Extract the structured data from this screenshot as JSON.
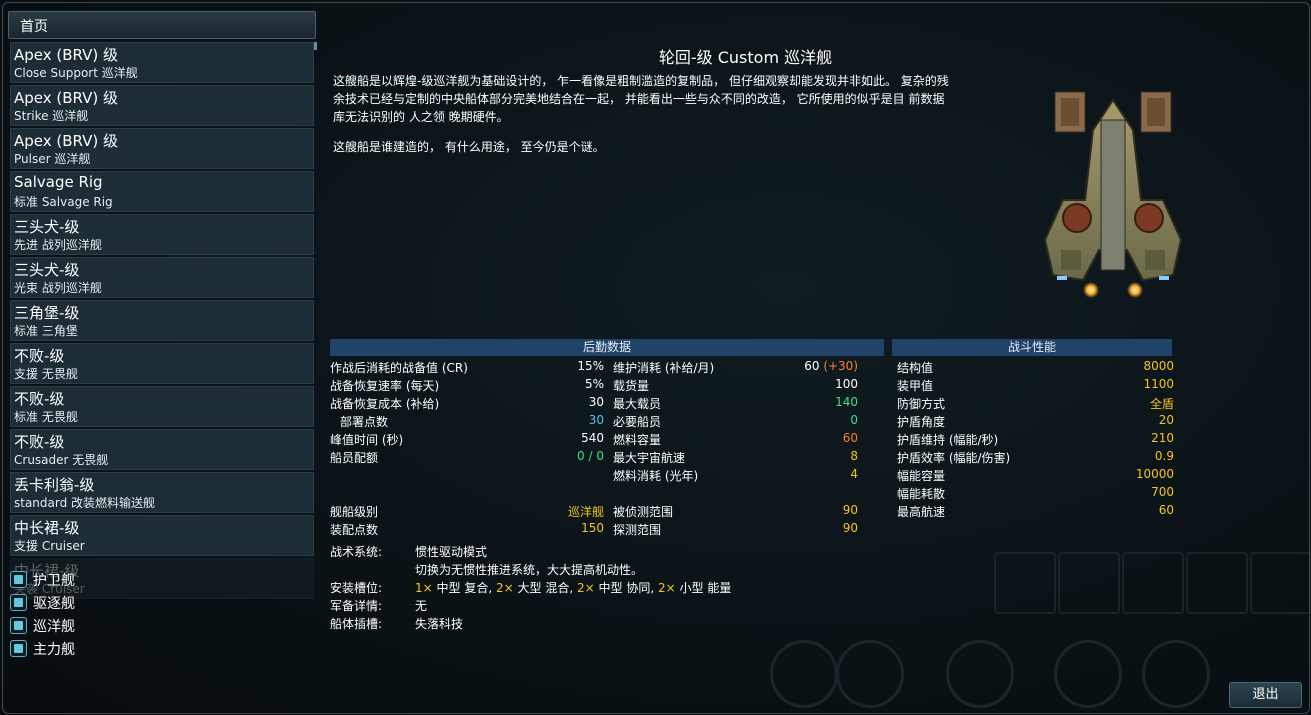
{
  "nav": {
    "home_label": "首页",
    "exit_label": "退出"
  },
  "ships": [
    {
      "name": "Apex (BRV) 级",
      "variant": "Close Support 巡洋舰"
    },
    {
      "name": "Apex (BRV) 级",
      "variant": "Strike 巡洋舰"
    },
    {
      "name": "Apex (BRV) 级",
      "variant": "Pulser 巡洋舰"
    },
    {
      "name": "Salvage Rig",
      "variant": "标准 Salvage Rig"
    },
    {
      "name": "三头犬-级",
      "variant": "先进 战列巡洋舰"
    },
    {
      "name": "三头犬-级",
      "variant": "光束 战列巡洋舰"
    },
    {
      "name": "三角堡-级",
      "variant": "标准 三角堡"
    },
    {
      "name": "不败-级",
      "variant": "支援 无畏舰"
    },
    {
      "name": "不败-级",
      "variant": "标准 无畏舰"
    },
    {
      "name": "不败-级",
      "variant": "Crusader 无畏舰"
    },
    {
      "name": "丢卡利翁-级",
      "variant": "standard 改装燃料输送舰"
    },
    {
      "name": "中长裙-级",
      "variant": "支援 Cruiser"
    },
    {
      "name": "中长裙-级",
      "variant": "突袭 Cruiser"
    }
  ],
  "categories": [
    {
      "label": "护卫舰",
      "checked": true
    },
    {
      "label": "驱逐舰",
      "checked": true
    },
    {
      "label": "巡洋舰",
      "checked": true
    },
    {
      "label": "主力舰",
      "checked": true
    }
  ],
  "detail": {
    "title": "轮回-级 Custom 巡洋舰",
    "desc1": "这艘船是以辉煌-级巡洋舰为基础设计的， 乍一看像是粗制滥造的复制品， 但仔细观察却能发现并非如此。 复杂的残余技术已经与定制的中央船体部分完美地结合在一起， 并能看出一些与众不同的改造， 它所使用的似乎是目 前数据库无法识别的 人之领 晚期硬件。",
    "desc2": "这艘船是谁建造的， 有什么用途， 至今仍是个谜。"
  },
  "logistics": {
    "header": "后勤数据",
    "left": [
      {
        "label": "作战后消耗的战备值 (CR)",
        "value": "15%",
        "color": "white"
      },
      {
        "label": "战备恢复速率 (每天)",
        "value": "5%",
        "color": "white"
      },
      {
        "label": "战备恢复成本 (补给)",
        "value": "30",
        "color": "white"
      },
      {
        "label": "部署点数",
        "value": "30",
        "color": "cyan"
      },
      {
        "label": "峰值时间 (秒)",
        "value": "540",
        "color": "white"
      },
      {
        "label": "船员配额",
        "value": "0 / 0",
        "color": "green"
      }
    ],
    "right": [
      {
        "label": "维护消耗 (补给/月)",
        "value": "60",
        "bonus": "(+30)"
      },
      {
        "label": "载货量",
        "value": "100",
        "color": "white"
      },
      {
        "label": "最大载员",
        "value": "140",
        "color": "green"
      },
      {
        "label": "必要船员",
        "value": "0",
        "color": "green"
      },
      {
        "label": "燃料容量",
        "value": "60",
        "color": "orange"
      },
      {
        "label": "最大宇宙航速",
        "value": "8",
        "color": "gold"
      },
      {
        "label": "燃料消耗 (光年)",
        "value": "4",
        "color": "gold"
      }
    ],
    "left2": [
      {
        "label": "舰船级别",
        "value": "巡洋舰",
        "color": "gold"
      },
      {
        "label": "装配点数",
        "value": "150",
        "color": "gold"
      }
    ],
    "right2": [
      {
        "label": "被侦测范围",
        "value": "90",
        "color": "gold"
      },
      {
        "label": "探测范围",
        "value": "90",
        "color": "gold"
      }
    ]
  },
  "combat": {
    "header": "战斗性能",
    "rows": [
      {
        "label": "结构值",
        "value": "8000"
      },
      {
        "label": "装甲值",
        "value": "1100"
      },
      {
        "label": "防御方式",
        "value": "全盾"
      },
      {
        "label": "护盾角度",
        "value": "20"
      },
      {
        "label": "护盾维持 (幅能/秒)",
        "value": "210"
      },
      {
        "label": "护盾效率 (幅能/伤害)",
        "value": "0.9"
      },
      {
        "label": "幅能容量",
        "value": "10000"
      },
      {
        "label": "幅能耗散",
        "value": "700"
      },
      {
        "label": "最高航速",
        "value": "60"
      }
    ]
  },
  "systems": {
    "tactical_label": "战术系统:",
    "tactical_name": "惯性驱动模式",
    "tactical_desc": "切换为无惯性推进系统，大大提高机动性。",
    "slots_label": "安装槽位:",
    "slots": [
      {
        "count": "1×",
        "text": "中型 复合,"
      },
      {
        "count": "2×",
        "text": "大型 混合,"
      },
      {
        "count": "2×",
        "text": "中型 协同,"
      },
      {
        "count": "2×",
        "text": "小型 能量"
      }
    ],
    "armament_label": "军备详情:",
    "armament_value": "无",
    "hullmod_label": "船体插槽:",
    "hullmod_value": "失落科技"
  }
}
